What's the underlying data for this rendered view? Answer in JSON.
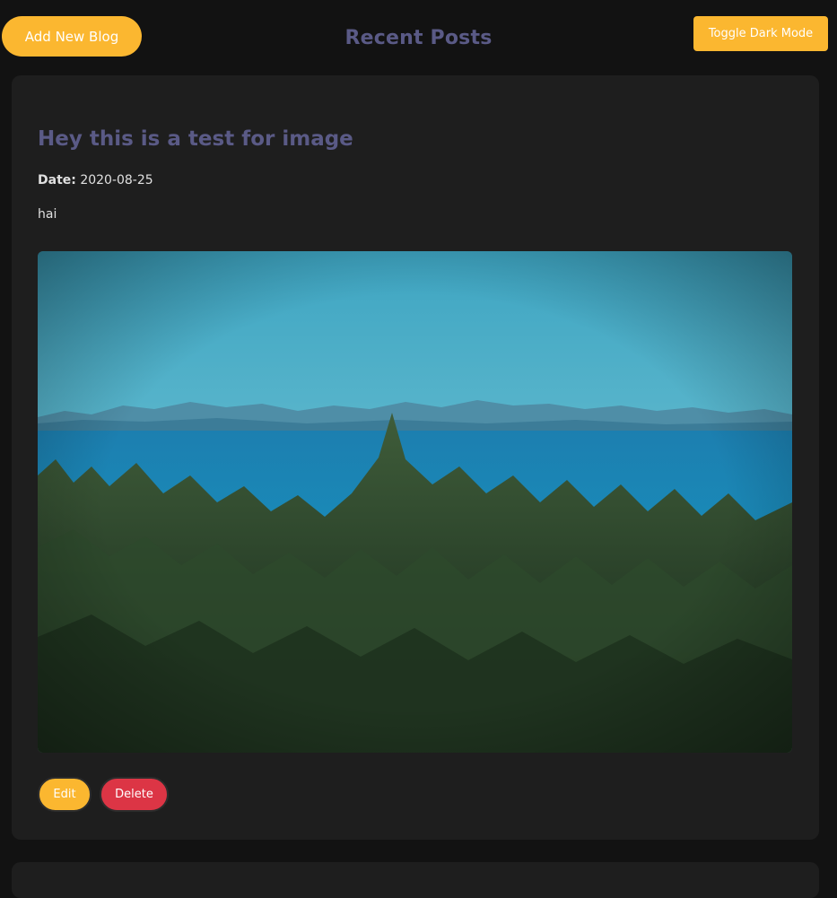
{
  "header": {
    "add_label": "Add New Blog",
    "title": "Recent Posts",
    "toggle_label": "Toggle Dark Mode"
  },
  "posts": [
    {
      "title": "Hey this is a test for image",
      "date_label": "Date:",
      "date": "2020-08-25",
      "body": "hai",
      "image": "landscape-photo: evergreen forest overlooking blue sea and distant mountains",
      "edit_label": "Edit",
      "delete_label": "Delete"
    }
  ],
  "colors": {
    "background": "#121212",
    "card": "#1e1e1e",
    "accent": "#fbb730",
    "danger": "#dc3545",
    "title": "#5a5a86"
  }
}
